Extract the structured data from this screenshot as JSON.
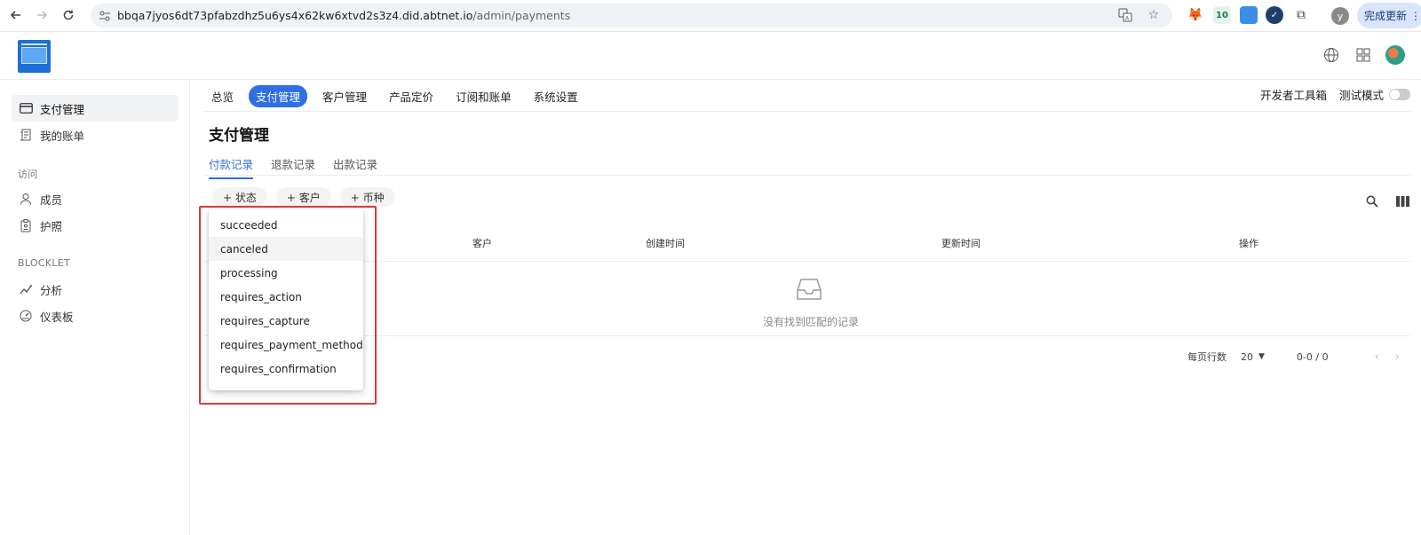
{
  "browser": {
    "url_host": "bbqa7jyos6dt73pfabzdhz5u6ys4x62kw6xtvd2s3z4.did.abtnet.io",
    "url_path": "/admin/payments",
    "update_label": "完成更新",
    "profile_initial": "y",
    "ext_badge": "10"
  },
  "sidebar": {
    "items": [
      {
        "label": "支付管理",
        "icon": "card-icon"
      },
      {
        "label": "我的账单",
        "icon": "receipt-icon"
      }
    ],
    "section_access": "访问",
    "access_items": [
      {
        "label": "成员",
        "icon": "user-icon"
      },
      {
        "label": "护照",
        "icon": "passport-icon"
      }
    ],
    "section_blocklet": "BLOCKLET",
    "blocklet_items": [
      {
        "label": "分析",
        "icon": "chart-icon"
      },
      {
        "label": "仪表板",
        "icon": "gauge-icon"
      }
    ]
  },
  "topnav": {
    "tabs": [
      "总览",
      "支付管理",
      "客户管理",
      "产品定价",
      "订阅和账单",
      "系统设置"
    ],
    "dev_tools": "开发者工具箱",
    "test_mode": "测试模式"
  },
  "page": {
    "title": "支付管理",
    "subtabs": [
      "付款记录",
      "退款记录",
      "出款记录"
    ],
    "filters": [
      "+ 状态",
      "+ 客户",
      "+ 币种"
    ]
  },
  "table": {
    "headers": [
      "客户",
      "创建时间",
      "更新时间",
      "操作"
    ],
    "empty_text": "没有找到匹配的记录"
  },
  "pagination": {
    "rows_label": "每页行数",
    "rows_value": "20",
    "range": "0-0 / 0"
  },
  "status_dropdown": {
    "options": [
      "succeeded",
      "canceled",
      "processing",
      "requires_action",
      "requires_capture",
      "requires_payment_method",
      "requires_confirmation"
    ]
  }
}
